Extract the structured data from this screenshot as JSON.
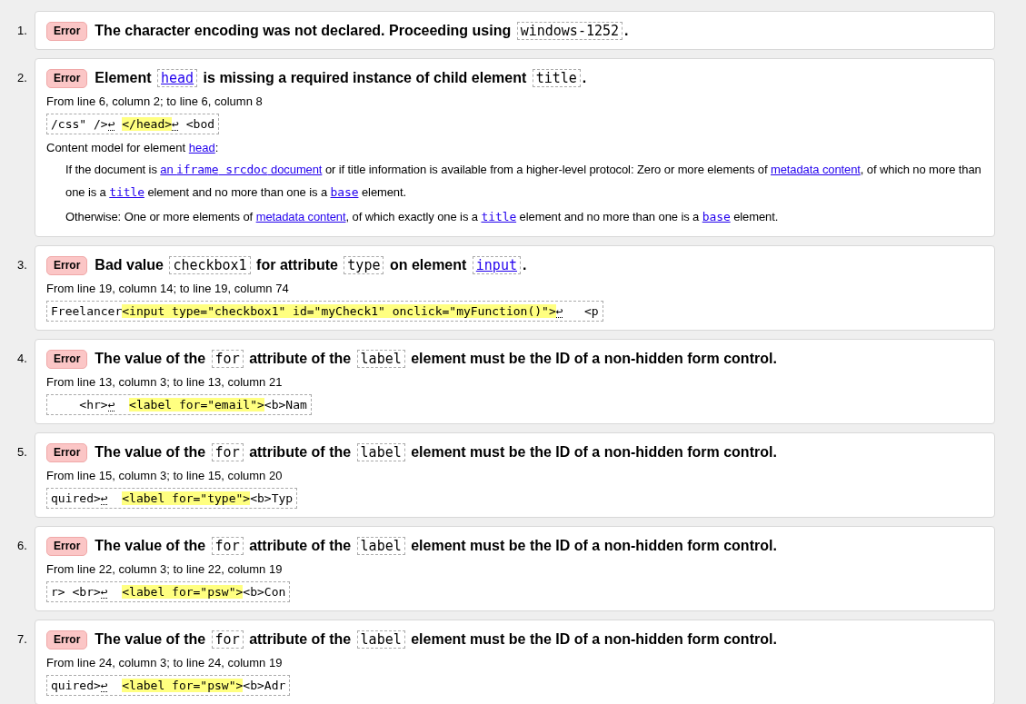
{
  "messages": [
    {
      "number": "1.",
      "badge": "Error",
      "title": [
        {
          "kind": "text",
          "text": "The character encoding was not declared. Proceeding using "
        },
        {
          "kind": "code",
          "text": "windows-1252"
        },
        {
          "kind": "text",
          "text": "."
        }
      ]
    },
    {
      "number": "2.",
      "badge": "Error",
      "title": [
        {
          "kind": "text",
          "text": "Element "
        },
        {
          "kind": "code-link",
          "text": "head"
        },
        {
          "kind": "text",
          "text": " is missing a required instance of child element "
        },
        {
          "kind": "code",
          "text": "title"
        },
        {
          "kind": "text",
          "text": "."
        }
      ],
      "location": "From line 6, column 2; to line 6, column 8",
      "extract": [
        {
          "kind": "plain",
          "text": "/css\" />"
        },
        {
          "kind": "return",
          "text": "↩ "
        },
        {
          "kind": "mark",
          "text": "</head>"
        },
        {
          "kind": "return",
          "text": "↩"
        },
        {
          "kind": "plain",
          "text": " <bod"
        }
      ],
      "content_model": {
        "heading": [
          {
            "kind": "text",
            "text": "Content model for element "
          },
          {
            "kind": "link",
            "parts": [
              {
                "kind": "plain",
                "text": "head"
              }
            ]
          },
          {
            "kind": "text",
            "text": ":"
          }
        ],
        "paragraphs": [
          [
            {
              "kind": "text",
              "text": "If the document is "
            },
            {
              "kind": "link",
              "parts": [
                {
                  "kind": "plain",
                  "text": "an "
                },
                {
                  "kind": "mono",
                  "text": "iframe"
                },
                {
                  "kind": "mono",
                  "text": " srcdoc"
                },
                {
                  "kind": "plain",
                  "text": " document"
                }
              ]
            },
            {
              "kind": "text",
              "text": " or if title information is available from a higher-level protocol: Zero or more elements of "
            },
            {
              "kind": "link",
              "parts": [
                {
                  "kind": "plain",
                  "text": "metadata content"
                }
              ]
            },
            {
              "kind": "text",
              "text": ", of which no more than one is a "
            },
            {
              "kind": "link",
              "parts": [
                {
                  "kind": "mono",
                  "text": "title"
                }
              ]
            },
            {
              "kind": "text",
              "text": " element and no more than one is a "
            },
            {
              "kind": "link",
              "parts": [
                {
                  "kind": "mono",
                  "text": "base"
                }
              ]
            },
            {
              "kind": "text",
              "text": " element."
            }
          ],
          [
            {
              "kind": "text",
              "text": "Otherwise: One or more elements of "
            },
            {
              "kind": "link",
              "parts": [
                {
                  "kind": "plain",
                  "text": "metadata content"
                }
              ]
            },
            {
              "kind": "text",
              "text": ", of which exactly one is a "
            },
            {
              "kind": "link",
              "parts": [
                {
                  "kind": "mono",
                  "text": "title"
                }
              ]
            },
            {
              "kind": "text",
              "text": " element and no more than one is a "
            },
            {
              "kind": "link",
              "parts": [
                {
                  "kind": "mono",
                  "text": "base"
                }
              ]
            },
            {
              "kind": "text",
              "text": " element."
            }
          ]
        ]
      }
    },
    {
      "number": "3.",
      "badge": "Error",
      "title": [
        {
          "kind": "text",
          "text": "Bad value "
        },
        {
          "kind": "code",
          "text": "checkbox1"
        },
        {
          "kind": "text",
          "text": " for attribute "
        },
        {
          "kind": "code",
          "text": "type"
        },
        {
          "kind": "text",
          "text": " on element "
        },
        {
          "kind": "code-link",
          "text": "input"
        },
        {
          "kind": "text",
          "text": "."
        }
      ],
      "location": "From line 19, column 14; to line 19, column 74",
      "extract": [
        {
          "kind": "plain",
          "text": "Freelancer"
        },
        {
          "kind": "mark",
          "text": "<input type=\"checkbox1\" id=\"myCheck1\" onclick=\"myFunction()\">"
        },
        {
          "kind": "return",
          "text": "↩"
        },
        {
          "kind": "plain",
          "text": "   <p"
        }
      ]
    },
    {
      "number": "4.",
      "badge": "Error",
      "title": [
        {
          "kind": "text",
          "text": "The value of the "
        },
        {
          "kind": "code",
          "text": "for"
        },
        {
          "kind": "text",
          "text": " attribute of the "
        },
        {
          "kind": "code",
          "text": "label"
        },
        {
          "kind": "text",
          "text": " element must be the ID of a non-hidden form control."
        }
      ],
      "location": "From line 13, column 3; to line 13, column 21",
      "extract": [
        {
          "kind": "plain",
          "text": "    <hr>"
        },
        {
          "kind": "return",
          "text": "↩  "
        },
        {
          "kind": "mark",
          "text": "<label for=\"email\">"
        },
        {
          "kind": "plain",
          "text": "<b>Nam"
        }
      ]
    },
    {
      "number": "5.",
      "badge": "Error",
      "title": [
        {
          "kind": "text",
          "text": "The value of the "
        },
        {
          "kind": "code",
          "text": "for"
        },
        {
          "kind": "text",
          "text": " attribute of the "
        },
        {
          "kind": "code",
          "text": "label"
        },
        {
          "kind": "text",
          "text": " element must be the ID of a non-hidden form control."
        }
      ],
      "location": "From line 15, column 3; to line 15, column 20",
      "extract": [
        {
          "kind": "plain",
          "text": "quired>"
        },
        {
          "kind": "return",
          "text": "↩  "
        },
        {
          "kind": "mark",
          "text": "<label for=\"type\">"
        },
        {
          "kind": "plain",
          "text": "<b>Typ"
        }
      ]
    },
    {
      "number": "6.",
      "badge": "Error",
      "title": [
        {
          "kind": "text",
          "text": "The value of the "
        },
        {
          "kind": "code",
          "text": "for"
        },
        {
          "kind": "text",
          "text": " attribute of the "
        },
        {
          "kind": "code",
          "text": "label"
        },
        {
          "kind": "text",
          "text": " element must be the ID of a non-hidden form control."
        }
      ],
      "location": "From line 22, column 3; to line 22, column 19",
      "extract": [
        {
          "kind": "plain",
          "text": "r> <br>"
        },
        {
          "kind": "return",
          "text": "↩  "
        },
        {
          "kind": "mark",
          "text": "<label for=\"psw\">"
        },
        {
          "kind": "plain",
          "text": "<b>Con"
        }
      ]
    },
    {
      "number": "7.",
      "badge": "Error",
      "title": [
        {
          "kind": "text",
          "text": "The value of the "
        },
        {
          "kind": "code",
          "text": "for"
        },
        {
          "kind": "text",
          "text": " attribute of the "
        },
        {
          "kind": "code",
          "text": "label"
        },
        {
          "kind": "text",
          "text": " element must be the ID of a non-hidden form control."
        }
      ],
      "location": "From line 24, column 3; to line 24, column 19",
      "extract": [
        {
          "kind": "plain",
          "text": "quired>"
        },
        {
          "kind": "return",
          "text": "↩  "
        },
        {
          "kind": "mark",
          "text": "<label for=\"psw\">"
        },
        {
          "kind": "plain",
          "text": "<b>Adr"
        }
      ]
    }
  ]
}
